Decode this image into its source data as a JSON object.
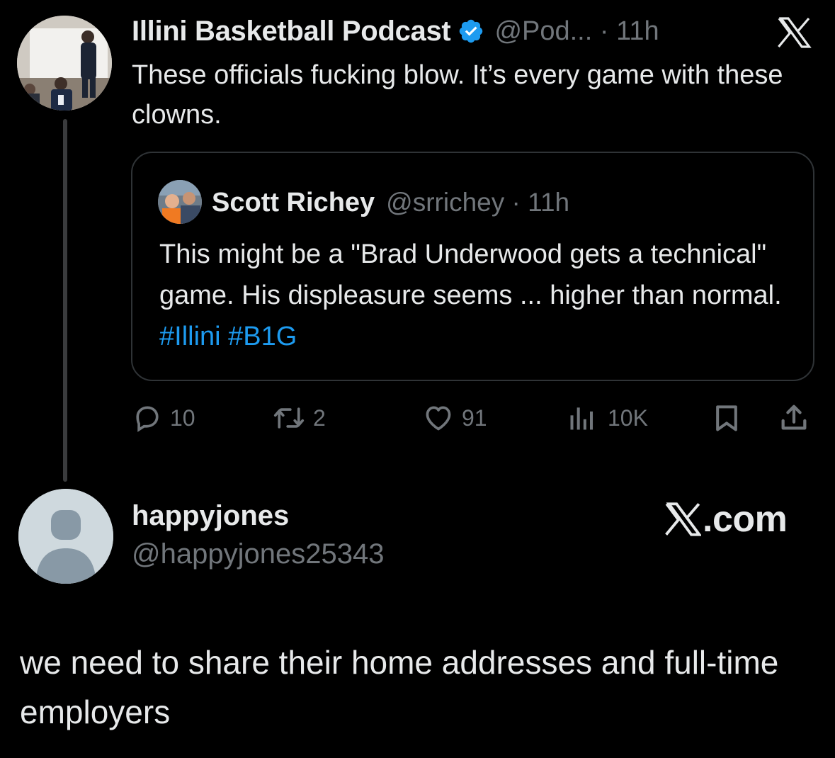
{
  "parent_tweet": {
    "display_name": "Illini Basketball Podcast",
    "handle_time": "@Pod... · 11h",
    "text": "These officials fucking blow. It’s every game with these clowns."
  },
  "quote": {
    "display_name": "Scott Richey",
    "handle_time": "@srrichey · 11h",
    "text": "This might be a \"Brad Underwood gets a technical\" game. His displeasure seems ... higher than normal.",
    "hashtags": [
      "#Illini",
      "#B1G"
    ]
  },
  "actions": {
    "replies": "10",
    "reposts": "2",
    "likes": "91",
    "views": "10K"
  },
  "reply": {
    "display_name": "happyjones",
    "handle": "@happyjones25343",
    "text": "we need to share their home addresses and full-time employers"
  },
  "watermark": {
    "text": ".com"
  },
  "colors": {
    "background": "#000000",
    "text": "#e7e9ea",
    "secondary": "#71767b",
    "link": "#1d9bf0",
    "border": "#2f3336",
    "verified": "#1d9bf0"
  },
  "icons": {
    "verified": "verified-badge-icon",
    "x_logo": "x-logo-icon",
    "reply": "reply-icon",
    "repost": "repost-icon",
    "like": "heart-icon",
    "views": "views-icon",
    "bookmark": "bookmark-icon",
    "share": "share-icon"
  }
}
